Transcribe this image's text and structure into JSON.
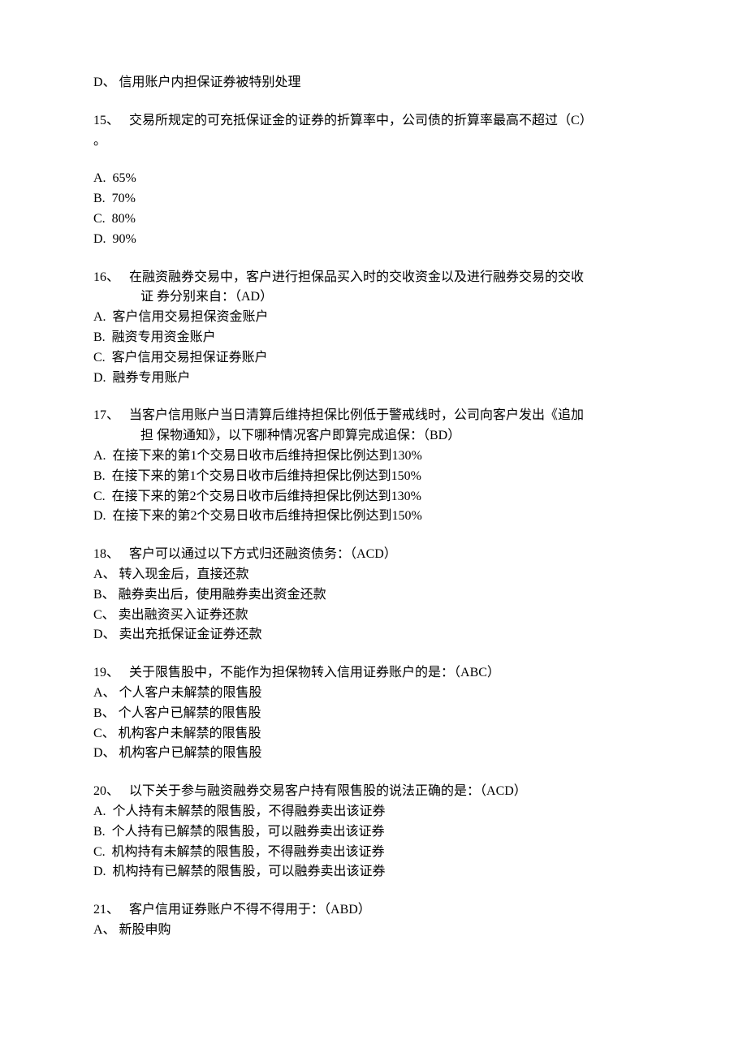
{
  "preQ15_optD": "D、 信用账户内担保证券被特别处理",
  "q15": {
    "num": "15、",
    "stem": "   交易所规定的可充抵保证金的证券的折算率中，公司债的折算率最高不超过（C）",
    "stem_cont": "。",
    "opts": [
      "A.  65%",
      "B.  70%",
      "C.  80%",
      "D.  90%"
    ]
  },
  "q16": {
    "num": "16、",
    "stem": "   在融资融券交易中，客户进行担保品买入时的交收资金以及进行融券交易的交收",
    "stem_cont": "证 券分别来自：（AD）",
    "opts": [
      "A.  客户信用交易担保资金账户",
      "B.  融资专用资金账户",
      "C.  客户信用交易担保证券账户",
      "D.  融券专用账户"
    ]
  },
  "q17": {
    "num": "17、",
    "stem": "   当客户信用账户当日清算后维持担保比例低于警戒线时，公司向客户发出《追加",
    "stem_cont": "担 保物通知》，以下哪种情况客户即算完成追保：（BD）",
    "opts": [
      "A.  在接下来的第1个交易日收市后维持担保比例达到130%",
      "B.  在接下来的第1个交易日收市后维持担保比例达到150%",
      "C.  在接下来的第2个交易日收市后维持担保比例达到130%",
      "D.  在接下来的第2个交易日收市后维持担保比例达到150%"
    ]
  },
  "q18": {
    "num": "18、",
    "stem": "   客户可以通过以下方式归还融资债务：（ACD）",
    "opts": [
      "A、 转入现金后，直接还款",
      "B、 融券卖出后，使用融券卖出资金还款",
      "C、 卖出融资买入证券还款",
      "D、 卖出充抵保证金证券还款"
    ]
  },
  "q19": {
    "num": "19、",
    "stem": "   关于限售股中，不能作为担保物转入信用证券账户的是：（ABC）",
    "opts": [
      "A、 个人客户未解禁的限售股",
      "B、 个人客户已解禁的限售股",
      "C、 机构客户未解禁的限售股",
      "D、 机构客户已解禁的限售股"
    ]
  },
  "q20": {
    "num": "20、",
    "stem": "   以下关于参与融资融券交易客户持有限售股的说法正确的是：（ACD）",
    "opts": [
      "A.  个人持有未解禁的限售股，不得融券卖出该证券",
      "B.  个人持有已解禁的限售股，可以融券卖出该证券",
      "C.  机构持有未解禁的限售股，不得融券卖出该证券",
      "D.  机构持有已解禁的限售股，可以融券卖出该证券"
    ]
  },
  "q21": {
    "num": "21、",
    "stem": "   客户信用证券账户不得不得用于：（ABD）",
    "opts": [
      "A、 新股申购"
    ]
  }
}
